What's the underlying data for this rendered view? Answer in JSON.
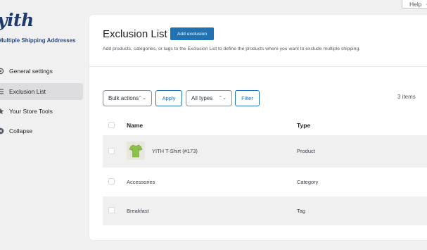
{
  "sidebar": {
    "logo_text": "yith",
    "plugin_name": "Multiple Shipping Addresses",
    "items": [
      {
        "label": "General settings",
        "icon": "gear-icon"
      },
      {
        "label": "Exclusion List",
        "icon": "list-icon",
        "active": true
      },
      {
        "label": "Your Store Tools",
        "icon": "star-icon"
      },
      {
        "label": "Collapse",
        "icon": "collapse-icon"
      }
    ]
  },
  "header": {
    "help_label": "Help"
  },
  "main": {
    "title": "Exclusion List",
    "add_button_label": "Add exclusion",
    "description": "Add products, categories, or tags to the Exclusion List to define the products where you want to exclude multiple shipping.",
    "toolbar": {
      "bulk_actions_label": "Bulk actions",
      "apply_label": "Apply",
      "types_label": "All types",
      "filter_label": "Filter",
      "items_count": "3 items"
    },
    "table": {
      "columns": [
        "Name",
        "Type"
      ],
      "rows": [
        {
          "name": "YITH T-Shirt (#173)",
          "type": "Product",
          "has_thumbnail": true
        },
        {
          "name": "Accessories",
          "type": "Category"
        },
        {
          "name": "Breakfast",
          "type": "Tag"
        }
      ]
    }
  },
  "colors": {
    "accent": "#2271b1",
    "logo": "#1f3a6f",
    "active_nav_bg": "#dcdcde",
    "shirt": "#8bc34a"
  }
}
